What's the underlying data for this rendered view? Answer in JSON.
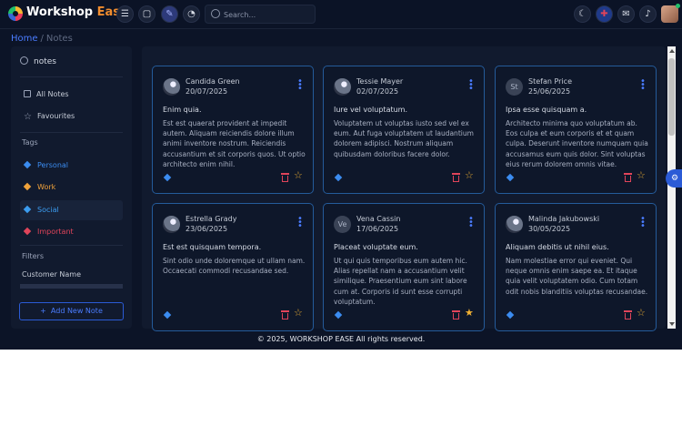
{
  "header": {
    "brand_main": "Workshop",
    "brand_accent": "Ease",
    "search_placeholder": "Search...",
    "icons": [
      "menu-icon",
      "calendar-icon",
      "pen-icon",
      "notes-icon",
      "moon-icon",
      "uk-flag-icon",
      "mail-icon",
      "bell-icon"
    ]
  },
  "breadcrumb": {
    "home": "Home",
    "separator": "/",
    "current": "Notes"
  },
  "sidebar": {
    "title": "notes",
    "items": [
      {
        "label": "All Notes"
      },
      {
        "label": "Favourites"
      }
    ],
    "tags_label": "Tags",
    "tags": [
      {
        "label": "Personal",
        "color": "#3b8cf0"
      },
      {
        "label": "Work",
        "color": "#f0a23b"
      },
      {
        "label": "Social",
        "color": "#3b9cf0"
      },
      {
        "label": "Important",
        "color": "#e0445a"
      }
    ],
    "filters_label": "Filters",
    "filter_item": "Customer Name",
    "add_button": "Add New Note"
  },
  "notes": [
    {
      "name": "Candida Green",
      "date": "20/07/2025",
      "avatar": "",
      "title": "Enim quia.",
      "body": "Est est quaerat provident at impedit autem. Aliquam reiciendis dolore illum animi inventore nostrum. Reiciendis accusantium et sit corporis quos. Ut optio architecto enim nihil.",
      "tag_color": "#3b8cf0",
      "fav": false
    },
    {
      "name": "Tessie Mayer",
      "date": "02/07/2025",
      "avatar": "",
      "title": "Iure vel voluptatum.",
      "body": "Voluptatem ut voluptas iusto sed vel ex eum. Aut fuga voluptatem ut laudantium dolorem adipisci. Nostrum aliquam quibusdam doloribus facere dolor.",
      "tag_color": "#3b8cf0",
      "fav": false
    },
    {
      "name": "Stefan Price",
      "date": "25/06/2025",
      "avatar": "St",
      "title": "Ipsa esse quisquam a.",
      "body": "Architecto minima quo voluptatum ab. Eos culpa et eum corporis et et quam culpa. Deserunt inventore numquam quia accusamus eum quis dolor. Sint voluptas eius rerum dolorem omnis vitae.",
      "tag_color": "#3b8cf0",
      "fav": false
    },
    {
      "name": "Estrella Grady",
      "date": "23/06/2025",
      "avatar": "",
      "title": "Est est quisquam tempora.",
      "body": "Sint odio unde doloremque ut ullam nam. Occaecati commodi recusandae sed.",
      "tag_color": "#3b8cf0",
      "fav": false
    },
    {
      "name": "Vena Cassin",
      "date": "17/06/2025",
      "avatar": "Ve",
      "title": "Placeat voluptate eum.",
      "body": "Ut qui quis temporibus eum autem hic. Alias repellat nam a accusantium velit similique. Praesentium eum sint labore cum at. Corporis id sunt esse corrupti voluptatum.",
      "tag_color": "#3b8cf0",
      "fav": true
    },
    {
      "name": "Malinda Jakubowski",
      "date": "30/05/2025",
      "avatar": "",
      "title": "Aliquam debitis ut nihil eius.",
      "body": "Nam molestiae error qui eveniet. Qui neque omnis enim saepe ea. Et itaque quia velit voluptatem odio. Cum totam odit nobis blanditiis voluptas recusandae.",
      "tag_color": "#3b8cf0",
      "fav": false
    }
  ],
  "footer": "© 2025, WORKSHOP EASE All rights reserved."
}
